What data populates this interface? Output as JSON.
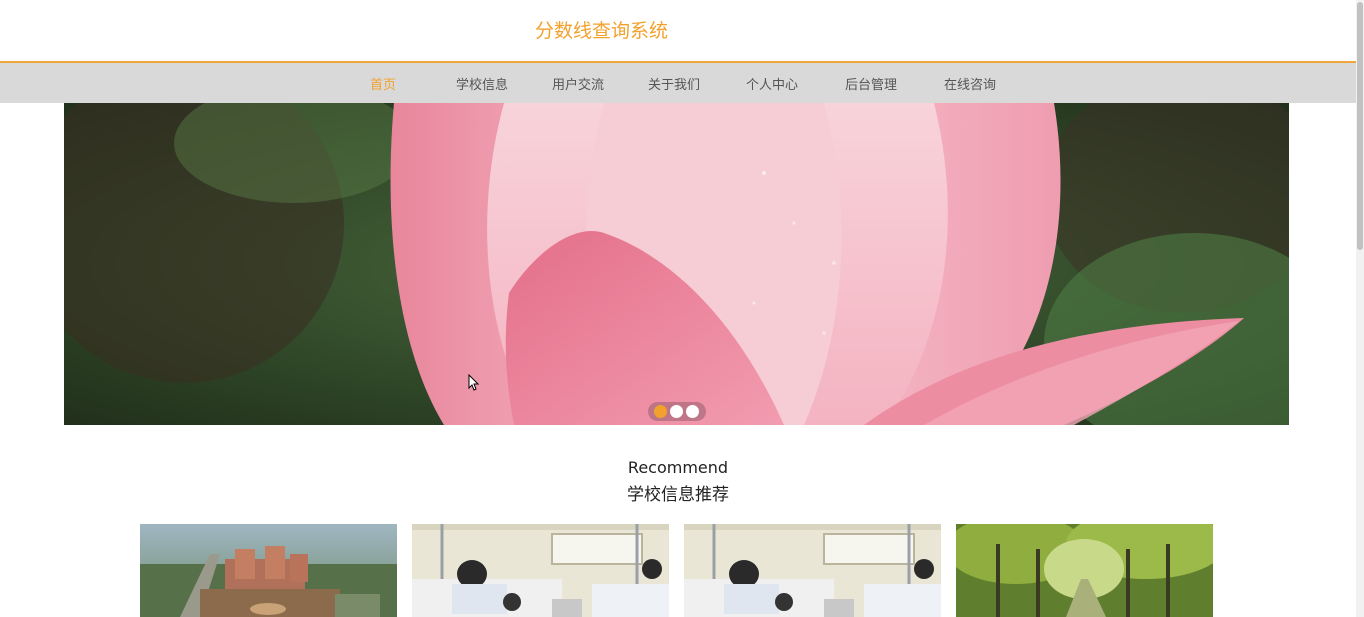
{
  "header": {
    "title": "分数线查询系统",
    "title_color": "#f2a12d"
  },
  "nav": {
    "items": [
      {
        "label": "首页",
        "active": true
      },
      {
        "label": "学校信息",
        "active": false
      },
      {
        "label": "用户交流",
        "active": false
      },
      {
        "label": "关于我们",
        "active": false
      },
      {
        "label": "个人中心",
        "active": false
      },
      {
        "label": "后台管理",
        "active": false
      },
      {
        "label": "在线咨询",
        "active": false
      }
    ],
    "background": "#d9d9d9",
    "accent": "#f2a12d"
  },
  "banner": {
    "slide_count": 3,
    "active_slide": 1
  },
  "recommend": {
    "title_en": "Recommend",
    "title_cn": "学校信息推荐"
  },
  "cards": [
    {
      "image": "campus-aerial-photo"
    },
    {
      "image": "dormitory-photo"
    },
    {
      "image": "dormitory-photo"
    },
    {
      "image": "tree-lined-road-photo"
    }
  ]
}
